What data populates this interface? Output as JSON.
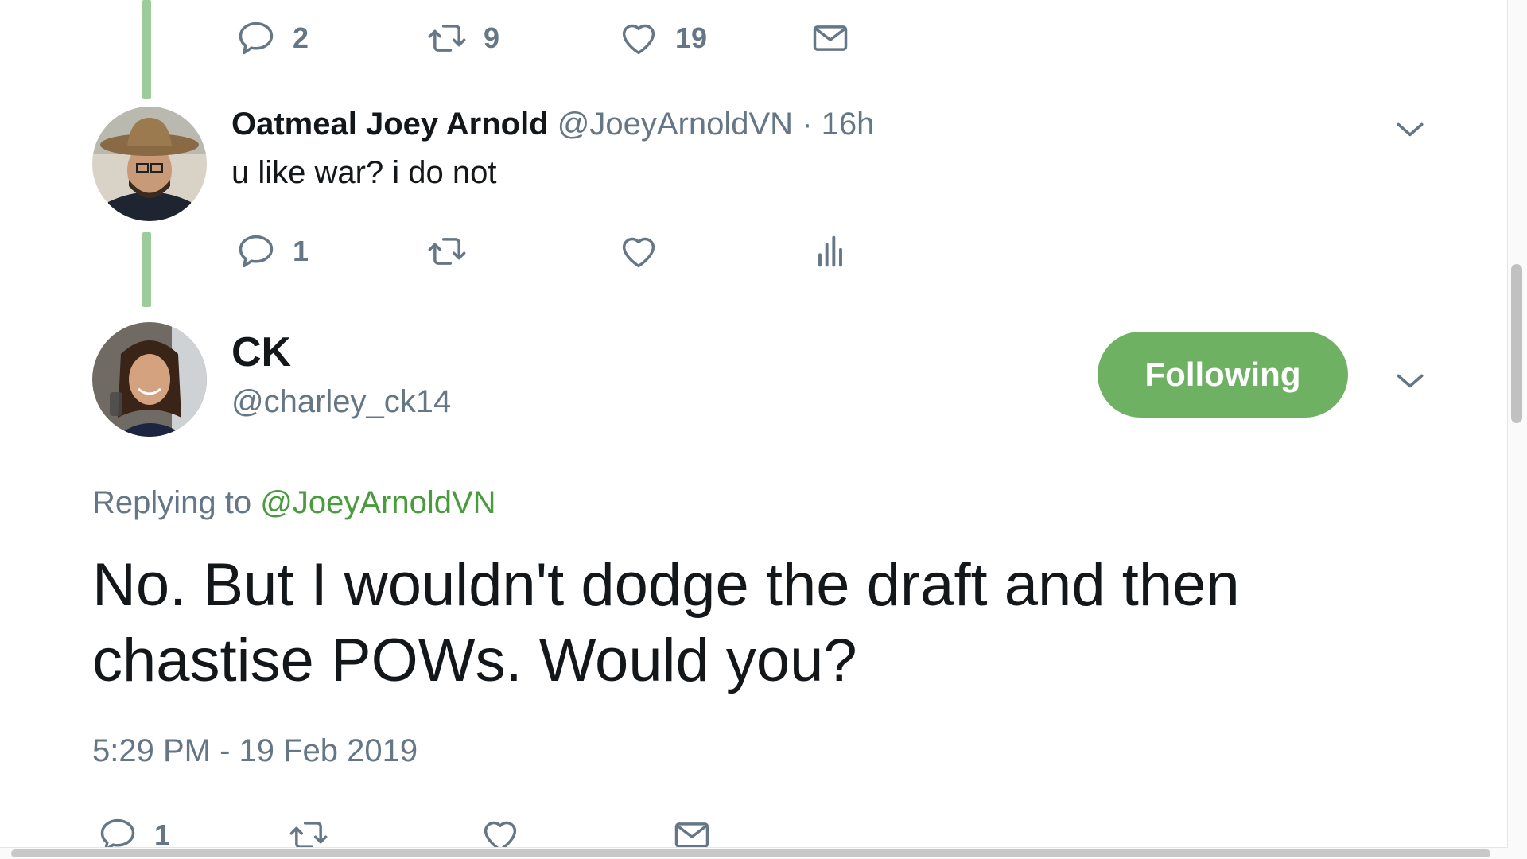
{
  "previous_tweet": {
    "actions": {
      "reply_count": "2",
      "retweet_count": "9",
      "like_count": "19"
    }
  },
  "reply_tweet": {
    "display_name": "Oatmeal Joey Arnold",
    "handle": "@JoeyArnoldVN",
    "separator": "·",
    "time_ago": "16h",
    "text": "u like war? i do not",
    "actions": {
      "reply_count": "1"
    }
  },
  "main_tweet": {
    "display_name": "CK",
    "handle": "@charley_ck14",
    "follow_button_label": "Following",
    "replying_prefix": "Replying to",
    "replying_to": "@JoeyArnoldVN",
    "text": "No. But I wouldn't dodge the draft and then chastise POWs. Would you?",
    "timestamp": "5:29 PM - 19 Feb 2019",
    "actions": {
      "reply_count": "1"
    }
  },
  "icons": {
    "reply": "reply-icon",
    "retweet": "retweet-icon",
    "like": "heart-icon",
    "dm": "envelope-icon",
    "analytics": "analytics-icon",
    "more": "chevron-down-icon"
  },
  "colors": {
    "accent_green": "#6fb162",
    "link_green": "#4a9a3e",
    "thread_line": "#9ccc9a",
    "muted": "#657786",
    "text": "#14171a"
  }
}
